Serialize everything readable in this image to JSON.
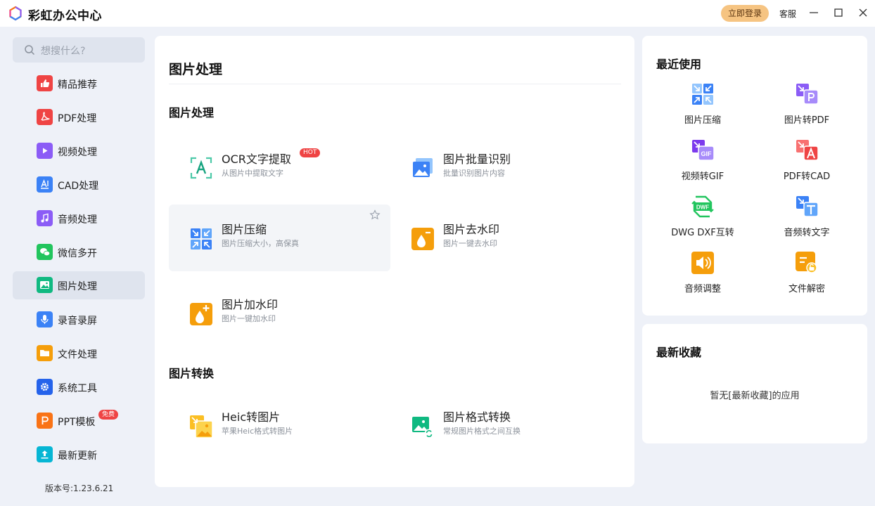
{
  "app": {
    "title": "彩虹办公中心",
    "login_label": "立即登录",
    "service_label": "客服"
  },
  "sidebar": {
    "search_placeholder": "想搜什么?",
    "items": [
      {
        "label": "精品推荐",
        "icon": "thumbs-up-icon",
        "color": "#ef4444"
      },
      {
        "label": "PDF处理",
        "icon": "pdf-icon",
        "color": "#ef4444"
      },
      {
        "label": "视频处理",
        "icon": "video-icon",
        "color": "#8b5cf6"
      },
      {
        "label": "CAD处理",
        "icon": "cad-icon",
        "color": "#3b82f6"
      },
      {
        "label": "音频处理",
        "icon": "music-icon",
        "color": "#8b5cf6"
      },
      {
        "label": "微信多开",
        "icon": "wechat-icon",
        "color": "#22c55e"
      },
      {
        "label": "图片处理",
        "icon": "image-icon",
        "color": "#10b981",
        "active": true
      },
      {
        "label": "录音录屏",
        "icon": "mic-icon",
        "color": "#3b82f6"
      },
      {
        "label": "文件处理",
        "icon": "folder-icon",
        "color": "#f59e0b"
      },
      {
        "label": "系统工具",
        "icon": "gear-icon",
        "color": "#2563eb"
      },
      {
        "label": "PPT模板",
        "icon": "ppt-icon",
        "color": "#f97316",
        "badge": "免费"
      },
      {
        "label": "最新更新",
        "icon": "upload-icon",
        "color": "#06b6d4"
      }
    ],
    "version": "版本号:1.23.6.21"
  },
  "main": {
    "title": "图片处理",
    "sections": [
      {
        "title": "图片处理",
        "cards": [
          {
            "title": "OCR文字提取",
            "desc": "从图片中提取文字",
            "badge": "HOT",
            "icon": "ocr-icon"
          },
          {
            "title": "图片批量识别",
            "desc": "批量识别图片内容",
            "icon": "image-batch-icon"
          },
          {
            "title": "图片压缩",
            "desc": "图片压缩大小，高保真",
            "icon": "compress-icon"
          },
          {
            "title": "图片去水印",
            "desc": "图片一键去水印",
            "icon": "remove-watermark-icon"
          },
          {
            "title": "图片加水印",
            "desc": "图片一键加水印",
            "icon": "add-watermark-icon"
          }
        ]
      },
      {
        "title": "图片转换",
        "cards": [
          {
            "title": "Heic转图片",
            "desc": "苹果Heic格式转图片",
            "icon": "heic-icon"
          },
          {
            "title": "图片格式转换",
            "desc": "常规图片格式之间互换",
            "icon": "format-convert-icon"
          }
        ]
      }
    ]
  },
  "recent": {
    "title": "最近使用",
    "items": [
      {
        "label": "图片压缩",
        "icon": "compress-icon"
      },
      {
        "label": "图片转PDF",
        "icon": "image-to-pdf-icon"
      },
      {
        "label": "视频转GIF",
        "icon": "gif-icon"
      },
      {
        "label": "PDF转CAD",
        "icon": "pdf-to-cad-icon"
      },
      {
        "label": "DWG DXF互转",
        "icon": "dwf-icon"
      },
      {
        "label": "音频转文字",
        "icon": "audio-to-text-icon"
      },
      {
        "label": "音频调整",
        "icon": "speaker-icon"
      },
      {
        "label": "文件解密",
        "icon": "unlock-file-icon"
      }
    ]
  },
  "favorites": {
    "title": "最新收藏",
    "empty_text": "暂无[最新收藏]的应用"
  }
}
